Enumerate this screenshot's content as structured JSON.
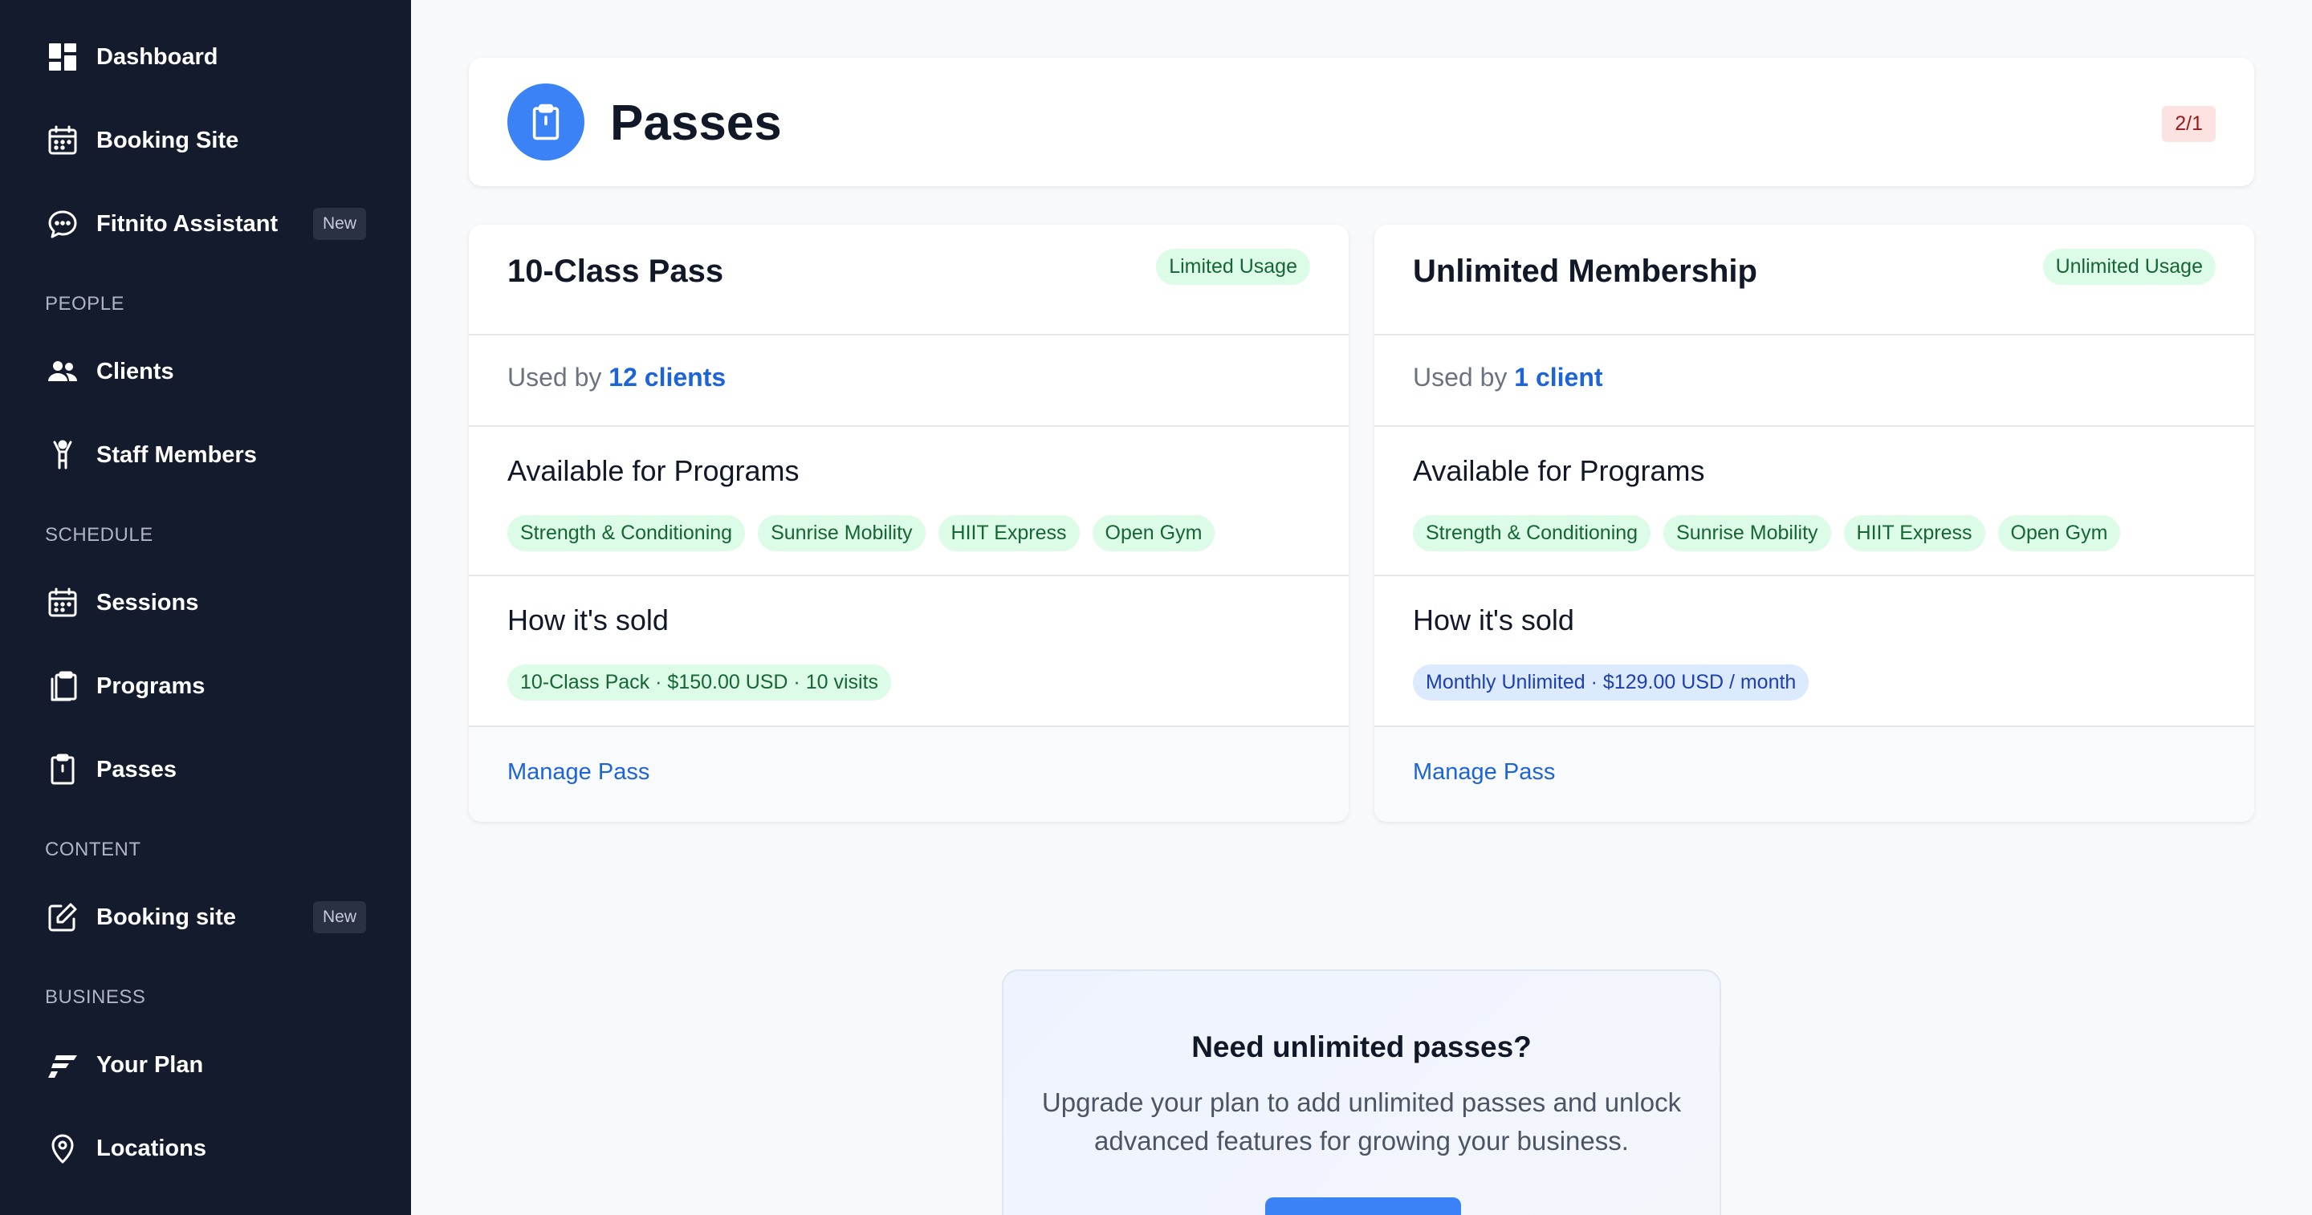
{
  "sidebar": {
    "items": [
      {
        "label": "Dashboard",
        "icon": "dashboard-icon"
      },
      {
        "label": "Booking Site",
        "icon": "calendar-icon"
      },
      {
        "label": "Fitnito Assistant",
        "icon": "chat-icon",
        "badge": "New"
      },
      {
        "label": "Clients",
        "icon": "users-icon"
      },
      {
        "label": "Staff Members",
        "icon": "person-icon"
      },
      {
        "label": "Sessions",
        "icon": "calendar-icon"
      },
      {
        "label": "Programs",
        "icon": "clipboard-stack-icon"
      },
      {
        "label": "Passes",
        "icon": "clipboard-icon"
      },
      {
        "label": "Booking site",
        "icon": "edit-icon",
        "badge": "New"
      },
      {
        "label": "Your Plan",
        "icon": "plan-logo-icon"
      },
      {
        "label": "Locations",
        "icon": "location-pin-icon"
      }
    ],
    "sections": [
      "PEOPLE",
      "SCHEDULE",
      "CONTENT",
      "BUSINESS"
    ]
  },
  "header": {
    "title": "Passes",
    "count": "2/1",
    "icon": "clipboard-icon"
  },
  "passes": [
    {
      "title": "10-Class Pass",
      "usage": "Limited Usage",
      "used_by_prefix": "Used by",
      "used_by_link": "12 clients",
      "programs_title": "Available for Programs",
      "programs": [
        "Strength & Conditioning",
        "Sunrise Mobility",
        "HIIT Express",
        "Open Gym"
      ],
      "sold_title": "How it's sold",
      "price": "10-Class Pack · $150.00 USD · 10 visits",
      "manage": "Manage Pass"
    },
    {
      "title": "Unlimited Membership",
      "usage": "Unlimited Usage",
      "used_by_prefix": "Used by",
      "used_by_link": "1 client",
      "programs_title": "Available for Programs",
      "programs": [
        "Strength & Conditioning",
        "Sunrise Mobility",
        "HIIT Express",
        "Open Gym"
      ],
      "sold_title": "How it's sold",
      "price": "Monthly Unlimited · $129.00 USD / month",
      "manage": "Manage Pass"
    }
  ],
  "promo": {
    "title": "Need unlimited passes?",
    "text": "Upgrade your plan to add unlimited passes and unlock advanced features for growing your business."
  },
  "colors": {
    "sidebar_bg": "#141b2d",
    "accent": "#3b82f6",
    "link": "#1d64d8",
    "chip_green_bg": "#dcfce7",
    "chip_blue_bg": "#dbeafe"
  }
}
